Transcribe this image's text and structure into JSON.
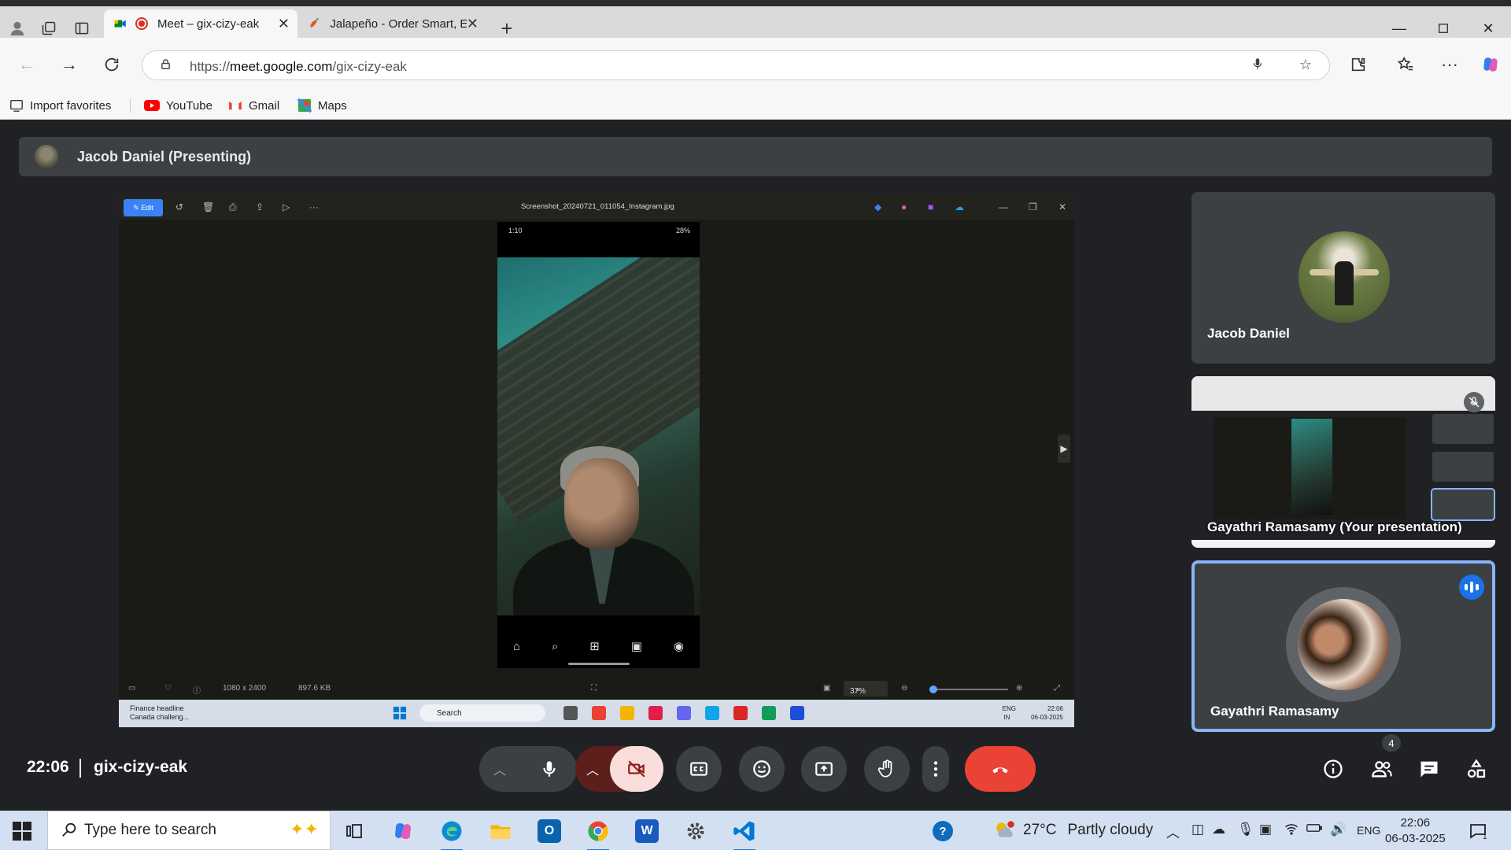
{
  "browser": {
    "tabs": [
      {
        "title": "Meet – gix-cizy-eak",
        "recording": true,
        "active": true
      },
      {
        "title": "Jalapeño - Order Smart, Eat Healt",
        "active": false
      }
    ],
    "address": {
      "prefix": "https://",
      "host": "meet.google.com",
      "path": "/gix-cizy-eak"
    },
    "bookmarks": [
      {
        "label": "Import favorites",
        "icon": "import-icon"
      },
      {
        "label": "YouTube",
        "icon": "youtube-icon",
        "color": "#ff0000"
      },
      {
        "label": "Gmail",
        "icon": "gmail-icon"
      },
      {
        "label": "Maps",
        "icon": "maps-icon"
      }
    ]
  },
  "meet": {
    "presenter_label": "Jacob Daniel (Presenting)",
    "time": "22:06",
    "meeting_code": "gix-cizy-eak",
    "participants_count": "4",
    "tiles": [
      {
        "name": "Jacob Daniel"
      },
      {
        "name": "Gayathri Ramasamy (Your presentation)"
      },
      {
        "name": "Gayathri Ramasamy",
        "speaking": true
      }
    ],
    "end_call_color": "#ea4335",
    "camera_off_color": "#f9dedc"
  },
  "shared_screen": {
    "edit_label": "Edit",
    "file_name": "Screenshot_20240721_011054_Instagram.jpg",
    "phone_time": "1:10",
    "phone_status": "28%",
    "dimensions": "1080 x 2400",
    "file_size": "897.6 KB",
    "zoom": "37%",
    "taskbar": {
      "news_title": "Finance headline",
      "news_sub": "Canada challeng...",
      "search": "Search",
      "lang": "ENG",
      "region": "IN",
      "time": "22:06",
      "date": "06-03-2025"
    }
  },
  "taskbar": {
    "search_placeholder": "Type here to search",
    "weather": {
      "temp": "27°C",
      "desc": "Partly cloudy"
    },
    "lang": "ENG",
    "time": "22:06",
    "date": "06-03-2025",
    "notification_count": "1"
  }
}
